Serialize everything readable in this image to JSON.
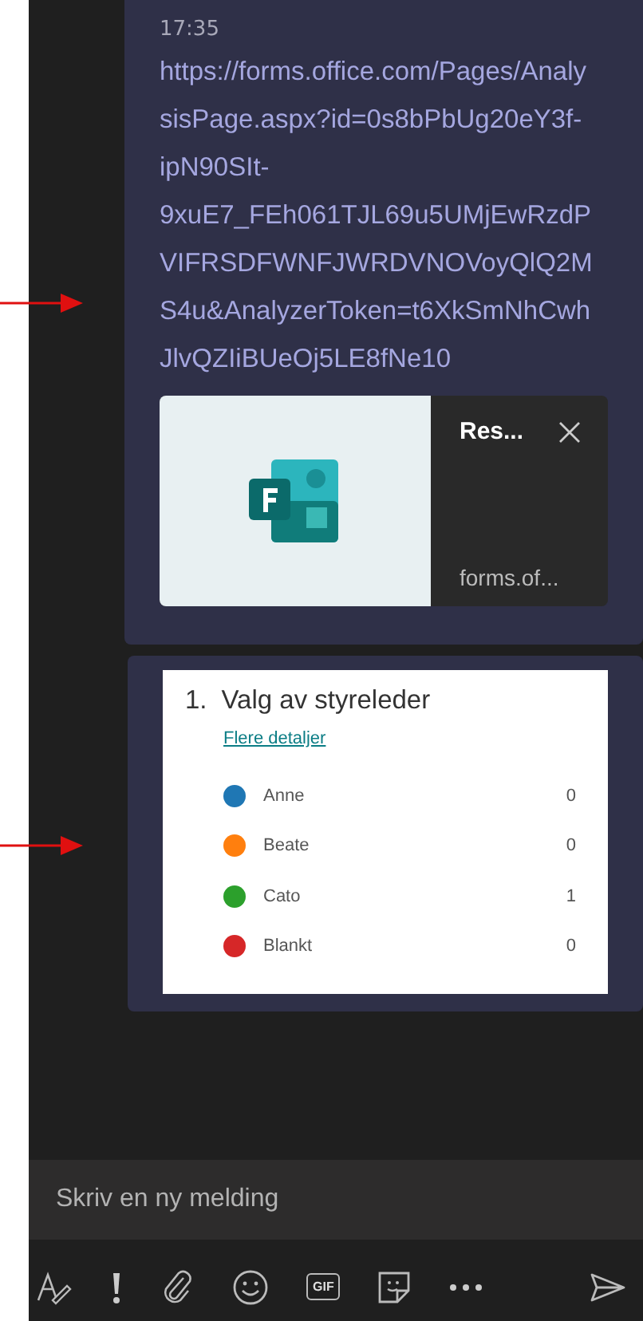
{
  "messages": [
    {
      "kind": "link",
      "time": "17:35",
      "link": "https://forms.office.com/Pages/AnalysisPage.aspx?id=0s8bPbUg20eY3f-ipN90SIt-9xuE7_FEh061TJL69u5UMjEwRzdPVIFRSDFWNFJWRDVNOVoyQlQ2MS4u&AnalyzerToken=t6XkSmNhCwhJlvQZIiBUeOj5LE8fNe10",
      "preview": {
        "title": "Res...",
        "site": "forms.of..."
      }
    },
    {
      "kind": "poll",
      "number": "1.",
      "question": "Valg av styreleder",
      "details_link": "Flere detaljer",
      "options": [
        {
          "name": "Anne",
          "count": "0",
          "color": "#1f77b4"
        },
        {
          "name": "Beate",
          "count": "0",
          "color": "#ff7f0e"
        },
        {
          "name": "Cato",
          "count": "1",
          "color": "#2ca02c"
        },
        {
          "name": "Blankt",
          "count": "0",
          "color": "#d62728"
        }
      ]
    }
  ],
  "compose": {
    "placeholder": "Skriv en ny melding"
  },
  "toolbar": [
    {
      "kind": "format"
    },
    {
      "kind": "important"
    },
    {
      "kind": "attach"
    },
    {
      "kind": "emoji"
    },
    {
      "kind": "gif",
      "label": "GIF"
    },
    {
      "kind": "sticker"
    },
    {
      "kind": "more"
    },
    {
      "kind": "send"
    }
  ]
}
